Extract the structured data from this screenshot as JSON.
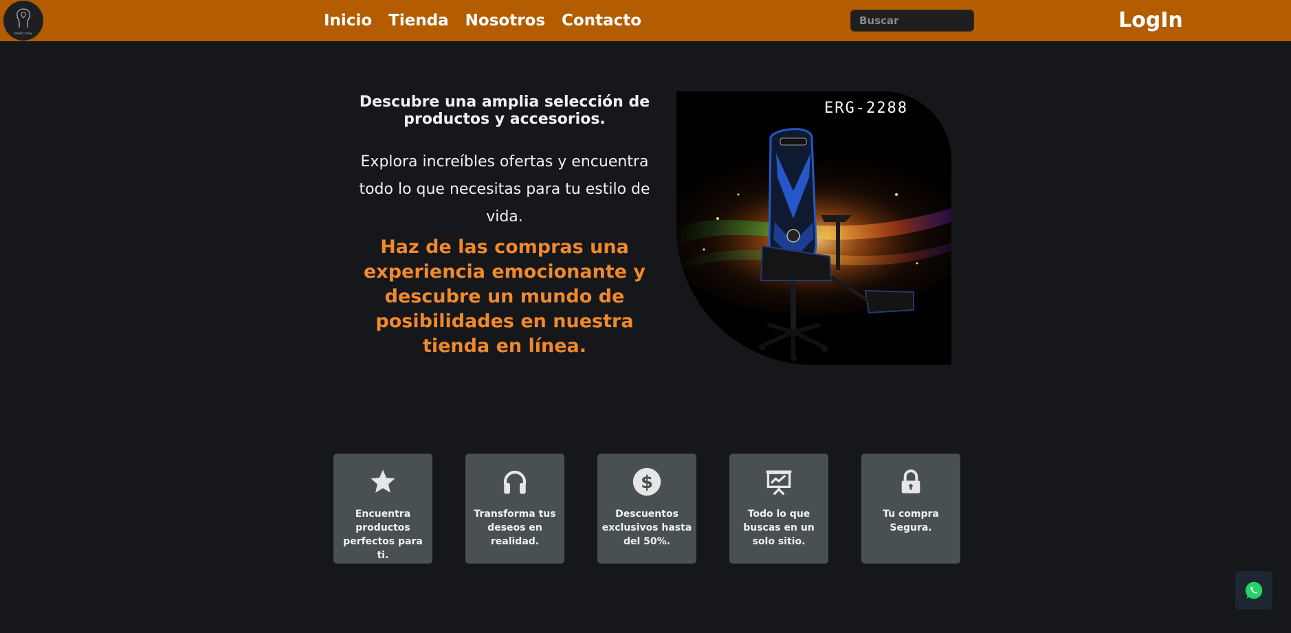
{
  "header": {
    "logo_text": "FRIKI PIXA",
    "nav": [
      {
        "label": "Inicio"
      },
      {
        "label": "Tienda"
      },
      {
        "label": "Nosotros"
      },
      {
        "label": "Contacto"
      }
    ],
    "search": {
      "placeholder": "Buscar",
      "value": ""
    },
    "login_label": "LogIn"
  },
  "hero": {
    "heading": "Descubre una amplia selección de productos y accesorios.",
    "body": "Explora increíbles ofertas y encuentra todo lo que necesitas para tu estilo de vida.",
    "highlight": "Haz de las compras una experiencia emocionante y descubre un mundo de posibilidades en nuestra tienda en línea.",
    "image_label": "ERG-2288",
    "image_icon": "gaming-chair-image"
  },
  "features": [
    {
      "icon": "star-icon",
      "text": "Encuentra productos perfectos para ti."
    },
    {
      "icon": "headphones-icon",
      "text": "Transforma tus deseos en realidad."
    },
    {
      "icon": "dollar-icon",
      "text": "Descuentos exclusivos hasta del 50%."
    },
    {
      "icon": "presentation-chart-icon",
      "text": "Todo lo que buscas en un solo sitio."
    },
    {
      "icon": "lock-icon",
      "text": "Tu compra Segura."
    }
  ],
  "whatsapp": {
    "icon": "whatsapp-icon"
  },
  "colors": {
    "navbar": "#b35c00",
    "background": "#15171a",
    "accent_text": "#f0892c",
    "card": "#495054",
    "whatsapp_green": "#25d366"
  }
}
